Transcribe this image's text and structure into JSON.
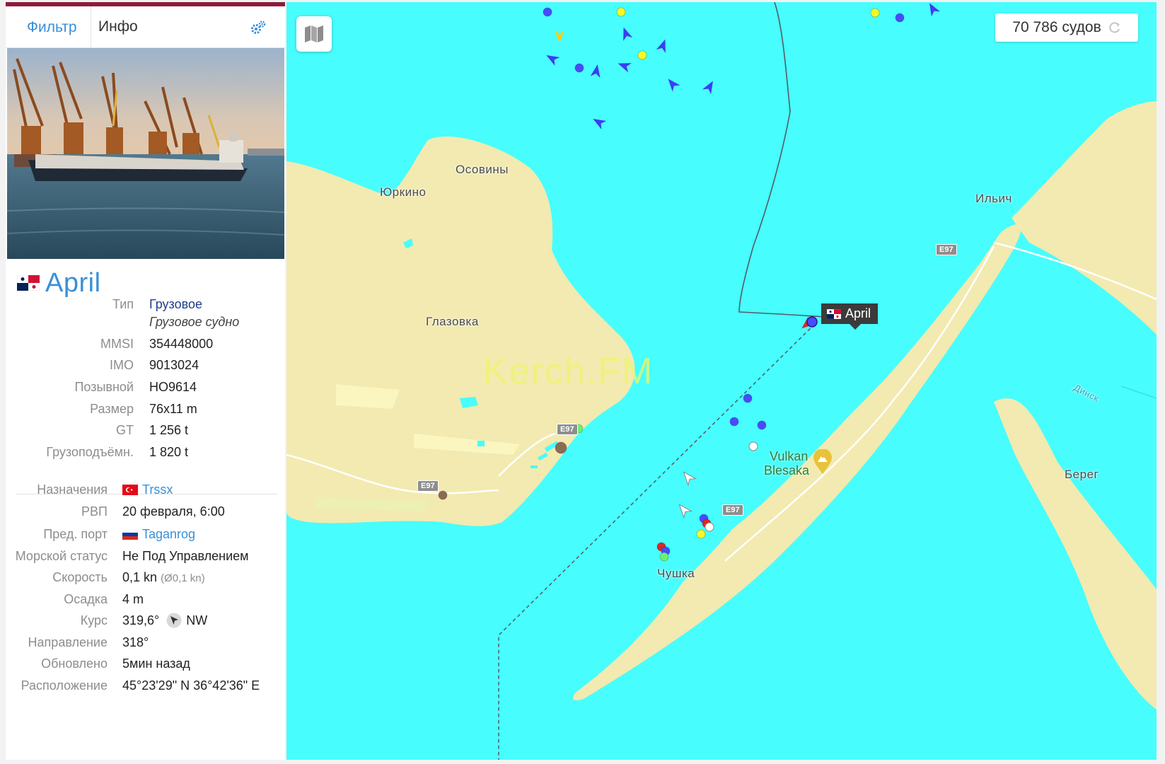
{
  "panel": {
    "tabs": {
      "filter": "Фильтр",
      "info": "Инфо"
    },
    "ship_name": "April",
    "details": [
      {
        "label": "Тип",
        "value": "Грузовое",
        "sub": "Грузовое судно"
      },
      {
        "label": "MMSI",
        "value": "354448000"
      },
      {
        "label": "IMO",
        "value": "9013024"
      },
      {
        "label": "Позывной",
        "value": "HO9614"
      },
      {
        "label": "Размер",
        "value": "76x11 m"
      },
      {
        "label": "GT",
        "value": "1 256 t"
      },
      {
        "label": "Грузоподъёмн.",
        "value": "1 820 t"
      }
    ],
    "voyage": [
      {
        "label": "Назначения",
        "value": "Trssx"
      },
      {
        "label": "РВП",
        "value": "20 февраля, 6:00"
      },
      {
        "label": "Пред. порт",
        "value": "Taganrog"
      },
      {
        "label": "Морской статус",
        "value": "Не Под Управлением"
      },
      {
        "label": "Скорость",
        "value": "0,1 kn",
        "extra": "(Ø0,1 kn)"
      },
      {
        "label": "Осадка",
        "value": "4 m"
      },
      {
        "label": "Курс",
        "value": "319,6°",
        "extra": "NW"
      },
      {
        "label": "Направление",
        "value": "318°"
      },
      {
        "label": "Обновлено",
        "value": "5мин назад"
      },
      {
        "label": "Расположение",
        "value": "45°23'29\" N 36°42'36\" E"
      }
    ]
  },
  "map": {
    "vessel_count": "70 786 судов",
    "selected_label": "April",
    "places": {
      "osoviny": "Осовины",
      "yurkino": "Юркино",
      "glazovka": "Глазовка",
      "ilich": "Ильич",
      "chushka": "Чушка",
      "bereg": "Берег",
      "dinsk": "Динск"
    },
    "poi": {
      "line1": "Vulkan",
      "line2": "Blesaka"
    },
    "road": "E97",
    "watermark": "Kerch.FM"
  },
  "colors": {
    "sea": "#47fdfd",
    "land": "#f2eab0",
    "accent": "#3a8fd8",
    "header": "#8e1b3a"
  },
  "icons": [
    "gear-icon",
    "map-layers-icon",
    "refresh-icon",
    "course-arrow-icon",
    "mountain-icon"
  ]
}
